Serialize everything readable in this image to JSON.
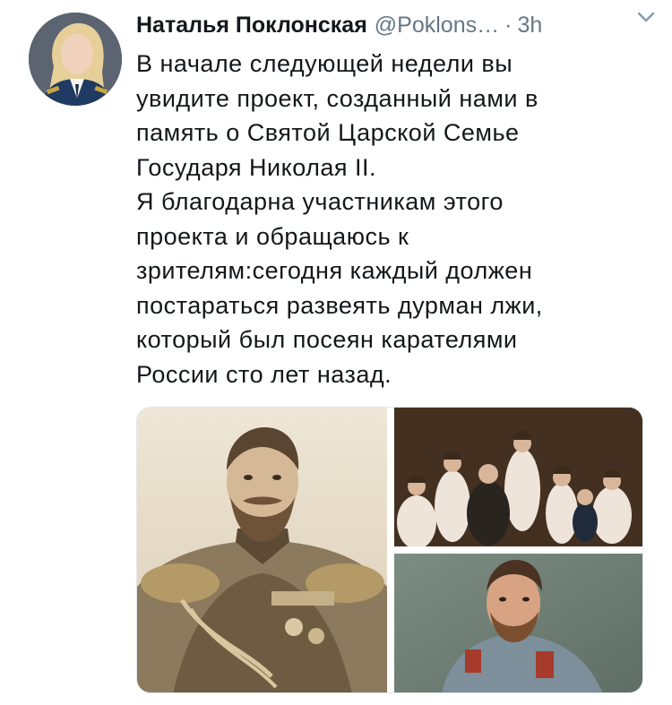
{
  "tweet": {
    "author_name": "Наталья Поклонская",
    "handle": "@Poklons…",
    "separator": "·",
    "time": "3h",
    "text": "В начале следующей недели вы\nувидите проект, созданный нами в\nпамять о Святой Царской Семье\nГосударя Николая II.\nЯ благодарна участникам этого\nпроекта и обращаюсь к\nзрителям:сегодня каждый должен\nпостараться развеять дурман лжи,\nкоторый был посеян карателями\nРоссии сто лет назад."
  },
  "media": {
    "photos": [
      "portrait-photo",
      "family-photo",
      "painting-photo"
    ]
  },
  "icons": {
    "menu": "chevron-down-icon"
  },
  "colors": {
    "text": "#14171a",
    "secondary": "#657786",
    "border": "#e1e8ed"
  }
}
